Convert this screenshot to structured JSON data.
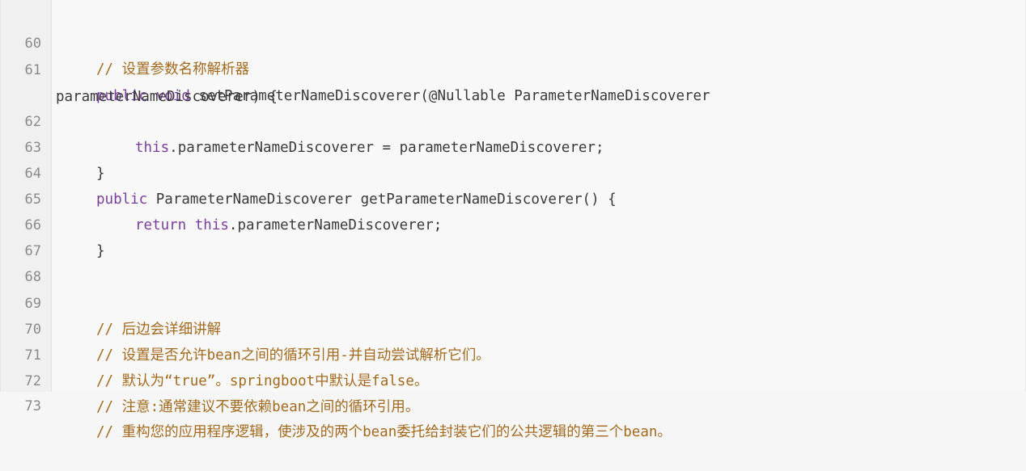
{
  "lines": [
    {
      "number": "60",
      "segments": [
        {
          "text": "// 设置参数名称解析器",
          "kind": "comment"
        }
      ]
    },
    {
      "number": "61",
      "segments": [
        {
          "text": "public void",
          "kind": "keyword"
        },
        {
          "text": " setParameterNameDiscoverer(@Nullable ParameterNameDiscoverer",
          "kind": "plain"
        }
      ]
    },
    {
      "number": "",
      "segments": [
        {
          "text": "parameterNameDiscoverer) {",
          "kind": "plain"
        }
      ]
    },
    {
      "number": "62",
      "segments": [
        {
          "text": "this",
          "kind": "keyword"
        },
        {
          "text": ".parameterNameDiscoverer = parameterNameDiscoverer;",
          "kind": "plain"
        }
      ]
    },
    {
      "number": "63",
      "segments": [
        {
          "text": "}",
          "kind": "plain"
        }
      ]
    },
    {
      "number": "64",
      "segments": [
        {
          "text": "public",
          "kind": "keyword"
        },
        {
          "text": " ParameterNameDiscoverer getParameterNameDiscoverer() {",
          "kind": "plain"
        }
      ]
    },
    {
      "number": "65",
      "segments": [
        {
          "text": "return",
          "kind": "keyword"
        },
        {
          "text": " ",
          "kind": "plain"
        },
        {
          "text": "this",
          "kind": "keyword"
        },
        {
          "text": ".parameterNameDiscoverer;",
          "kind": "plain"
        }
      ]
    },
    {
      "number": "66",
      "segments": [
        {
          "text": "}",
          "kind": "plain"
        }
      ]
    },
    {
      "number": "67",
      "segments": []
    },
    {
      "number": "68",
      "segments": []
    },
    {
      "number": "69",
      "segments": [
        {
          "text": "// 后边会详细讲解",
          "kind": "comment"
        }
      ]
    },
    {
      "number": "70",
      "segments": [
        {
          "text": "// 设置是否允许bean之间的循环引用-并自动尝试解析它们。",
          "kind": "comment"
        }
      ]
    },
    {
      "number": "71",
      "segments": [
        {
          "text": "// 默认为“true”。springboot中默认是false。",
          "kind": "comment"
        }
      ]
    },
    {
      "number": "72",
      "segments": [
        {
          "text": "// 注意:通常建议不要依赖bean之间的循环引用。",
          "kind": "comment"
        }
      ]
    },
    {
      "number": "73",
      "segments": [
        {
          "text": "// 重构您的应用程序逻辑，使涉及的两个bean委托给封装它们的公共逻辑的第三个bean。",
          "kind": "comment"
        }
      ]
    }
  ],
  "colors": {
    "keyword": "#7a3e9d",
    "comment": "#a36a1e",
    "plain": "#3a3a3a",
    "line_number": "#8a8a8a",
    "background": "#f8f8f8"
  }
}
